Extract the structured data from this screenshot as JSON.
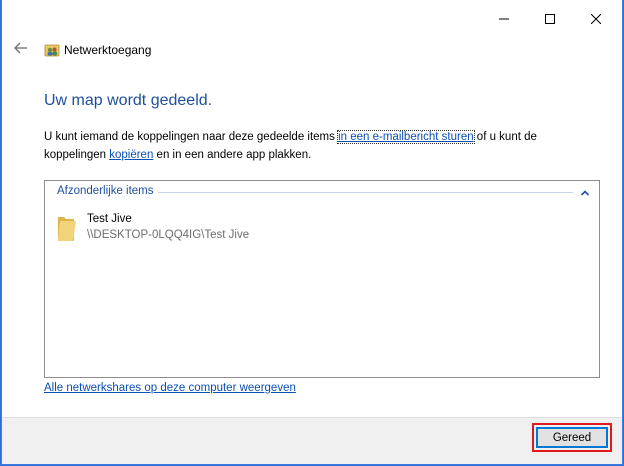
{
  "window": {
    "minimize_icon": "minimize-icon",
    "maximize_icon": "maximize-icon",
    "close_icon": "close-icon"
  },
  "header": {
    "back_icon": "back-arrow-icon",
    "app_icon": "network-sharing-icon",
    "title": "Netwerktoegang"
  },
  "main": {
    "heading": "Uw map wordt gedeeld.",
    "desc_part1": "U kunt iemand de koppelingen naar deze gedeelde items ",
    "email_link": "in een e-mailbericht sturen",
    "desc_part2": " of u kunt de koppelingen ",
    "copy_link": "kopiëren",
    "desc_part3": " en in een andere app plakken."
  },
  "list": {
    "group_title": "Afzonderlijke items",
    "collapse_icon": "chevron-up-icon",
    "items": [
      {
        "icon": "folder-icon",
        "name": "Test Jive",
        "path": "\\\\DESKTOP-0LQQ4IG\\Test Jive"
      }
    ]
  },
  "show_all_link": "Alle netwerkshares op deze computer weergeven",
  "footer": {
    "done_label": "Gereed"
  },
  "colors": {
    "heading": "#1f4e9e",
    "link": "#0a4fb5",
    "highlight": "#e0191e",
    "desktop": "#2f6fd6"
  }
}
